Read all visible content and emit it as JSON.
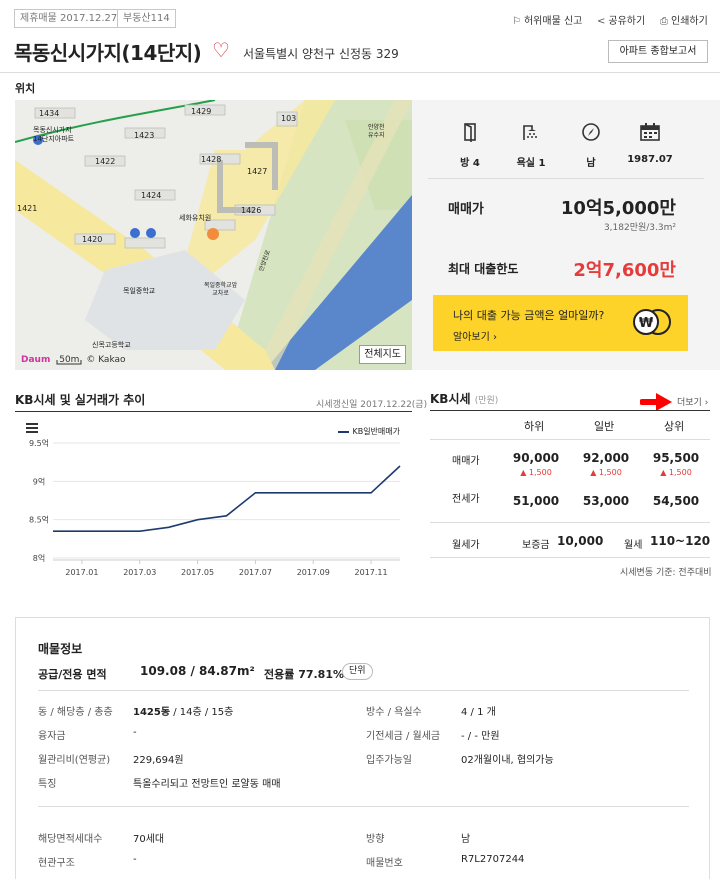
{
  "header": {
    "tag_date": "제휴매물 2017.12.27",
    "tag_broker": "부동산114",
    "links": {
      "report": "허위매물 신고",
      "share": "공유하기",
      "print": "인쇄하기"
    },
    "title": "목동신시가지(14단지)",
    "address": "서울특별시 양천구 신정동 329",
    "report_button": "아파트 종합보고서",
    "location_label": "위치"
  },
  "map": {
    "labels": {
      "b1434": "1434",
      "b1423": "1423",
      "b1429": "1429",
      "b103": "103",
      "b1422": "1422",
      "b1428": "1428",
      "b1427": "1427",
      "b1424": "1424",
      "b1426": "1426",
      "b1421": "1421",
      "b1420": "1420",
      "apt": "목동신시가지\n14단지아파트",
      "kinder": "세화유치원",
      "mid": "목일중학교",
      "high": "신목고등학교",
      "gate": "목일중학교앞\n교차로",
      "pump": "안양천\n유수지",
      "road": "안양천로",
      "scale": "50m"
    },
    "logo_brand": "Daum",
    "logo_text": "© Kakao",
    "full_map_button": "전체지도",
    "colors": {
      "land": "#ededea",
      "road": "#f6e99d",
      "water": "#5a86cc",
      "green": "#cfe0b5"
    }
  },
  "info": {
    "features": [
      {
        "icon": "door-icon",
        "label": "방 4"
      },
      {
        "icon": "shower-icon",
        "label": "욕실 1"
      },
      {
        "icon": "compass-icon",
        "label": "남"
      },
      {
        "icon": "calendar-icon",
        "label": "1987.07"
      }
    ],
    "price_label": "매매가",
    "price_value": "10억5,000만",
    "price_per_area": "3,182만원/3.3m²",
    "loan_label": "최대 대출한도",
    "loan_value": "2억7,600만",
    "promo_question": "나의 대출 가능 금액은  얼마일까?",
    "promo_link": "알아보기",
    "accent": "#e53b3b",
    "promo_bg": "#fdd32a"
  },
  "kb_chart": {
    "title": "KB시세 및 실거래가 추이",
    "updated": "시세갱신일 2017.12.22(금)",
    "legend": "KB일반매매가"
  },
  "chart_data": {
    "type": "line",
    "x": [
      "2016.12",
      "2017.01",
      "2017.02",
      "2017.03",
      "2017.04",
      "2017.05",
      "2017.06",
      "2017.07",
      "2017.08",
      "2017.09",
      "2017.10",
      "2017.11",
      "2017.12"
    ],
    "series": [
      {
        "name": "KB일반매매가",
        "values": [
          8.35,
          8.35,
          8.35,
          8.35,
          8.4,
          8.5,
          8.55,
          8.85,
          8.85,
          8.85,
          8.85,
          8.85,
          9.2
        ]
      }
    ],
    "y_ticks": [
      "8억",
      "8.5억",
      "9억",
      "9.5억"
    ],
    "y_tick_values": [
      8,
      8.5,
      9,
      9.5
    ],
    "x_ticks": [
      "2017.01",
      "2017.03",
      "2017.05",
      "2017.07",
      "2017.09",
      "2017.11"
    ],
    "ylim": [
      8,
      9.5
    ],
    "grid": true,
    "line_color": "#1f3b6e"
  },
  "kb_table": {
    "title": "KB시세",
    "unit": "(만원)",
    "more": "더보기",
    "columns": [
      "하위",
      "일반",
      "상위"
    ],
    "sale_label": "매매가",
    "sale_values": [
      "90,000",
      "92,000",
      "95,500"
    ],
    "sale_deltas": [
      "1,500",
      "1,500",
      "1,500"
    ],
    "jeonse_label": "전세가",
    "jeonse_values": [
      "51,000",
      "53,000",
      "54,500"
    ],
    "monthly_label": "월세가",
    "deposit_label": "보증금",
    "deposit_value": "10,000",
    "rent_label": "월세",
    "rent_value": "110~120",
    "note": "시세변동 기준: 전주대비"
  },
  "listing": {
    "title": "매물정보",
    "area_label": "공급/전용 면적",
    "area_value": "109.08 / 84.87m²",
    "rate_label": "전용률 77.81%",
    "unit_button": "단위",
    "rows": {
      "dong_label": "동 / 해당층 / 총층",
      "dong_value_bold": "1425동",
      "dong_value_rest": " / 14층 / 15층",
      "rooms_label": "방수 / 욕실수",
      "rooms_value": "4 / 1 개",
      "loan_label": "융자금",
      "loan_value": "-",
      "existing_label": "기전세금 / 월세금",
      "existing_value": "- / - 만원",
      "fee_label": "월관리비(연평균)",
      "fee_value": "229,694원",
      "movein_label": "입주가능일",
      "movein_value": "02개월이내, 협의가능",
      "feature_label": "특징",
      "feature_value": "특올수리되고 전망트인 로얄동 매매",
      "households_label": "해당면적세대수",
      "households_value": "70세대",
      "direction_label": "방향",
      "direction_value": "남",
      "structure_label": "현관구조",
      "structure_value": "-",
      "listing_no_label": "매물번호",
      "listing_no_value": "R7L2707244"
    }
  }
}
